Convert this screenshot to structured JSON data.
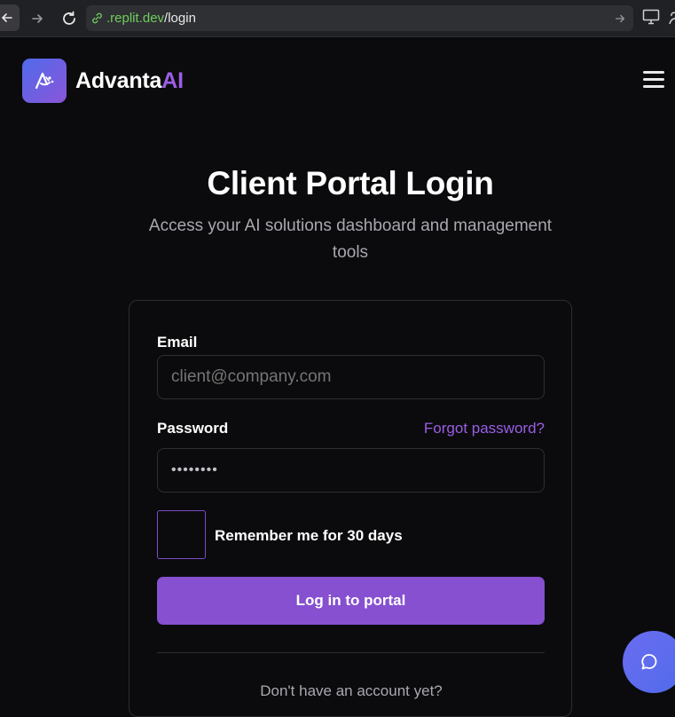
{
  "browser": {
    "url_host": ".replit.dev",
    "url_path": "/login",
    "icons": [
      "back-arrow-icon",
      "forward-arrow-icon",
      "reload-icon",
      "link-icon",
      "go-arrow-icon",
      "monitor-icon"
    ]
  },
  "header": {
    "brand_main": "Advanta",
    "brand_accent": "AI",
    "logo_icon": "advanta-logo-icon",
    "menu_icon": "hamburger-menu-icon"
  },
  "hero": {
    "title": "Client Portal Login",
    "subtitle": "Access your AI solutions dashboard and management tools"
  },
  "form": {
    "email_label": "Email",
    "email_placeholder": "client@company.com",
    "password_label": "Password",
    "password_value": "••••••••",
    "forgot_link": "Forgot password?",
    "remember_label": "Remember me for 30 days",
    "remember_checked": false,
    "submit_label": "Log in to portal",
    "signup_prompt": "Don't have an account yet?"
  },
  "chat": {
    "icon": "chat-bubble-icon"
  },
  "colors": {
    "background": "#0b0b0d",
    "accent_purple": "#9b5de5",
    "button_purple": "#8650d0",
    "muted_text": "#a8a8b0"
  }
}
